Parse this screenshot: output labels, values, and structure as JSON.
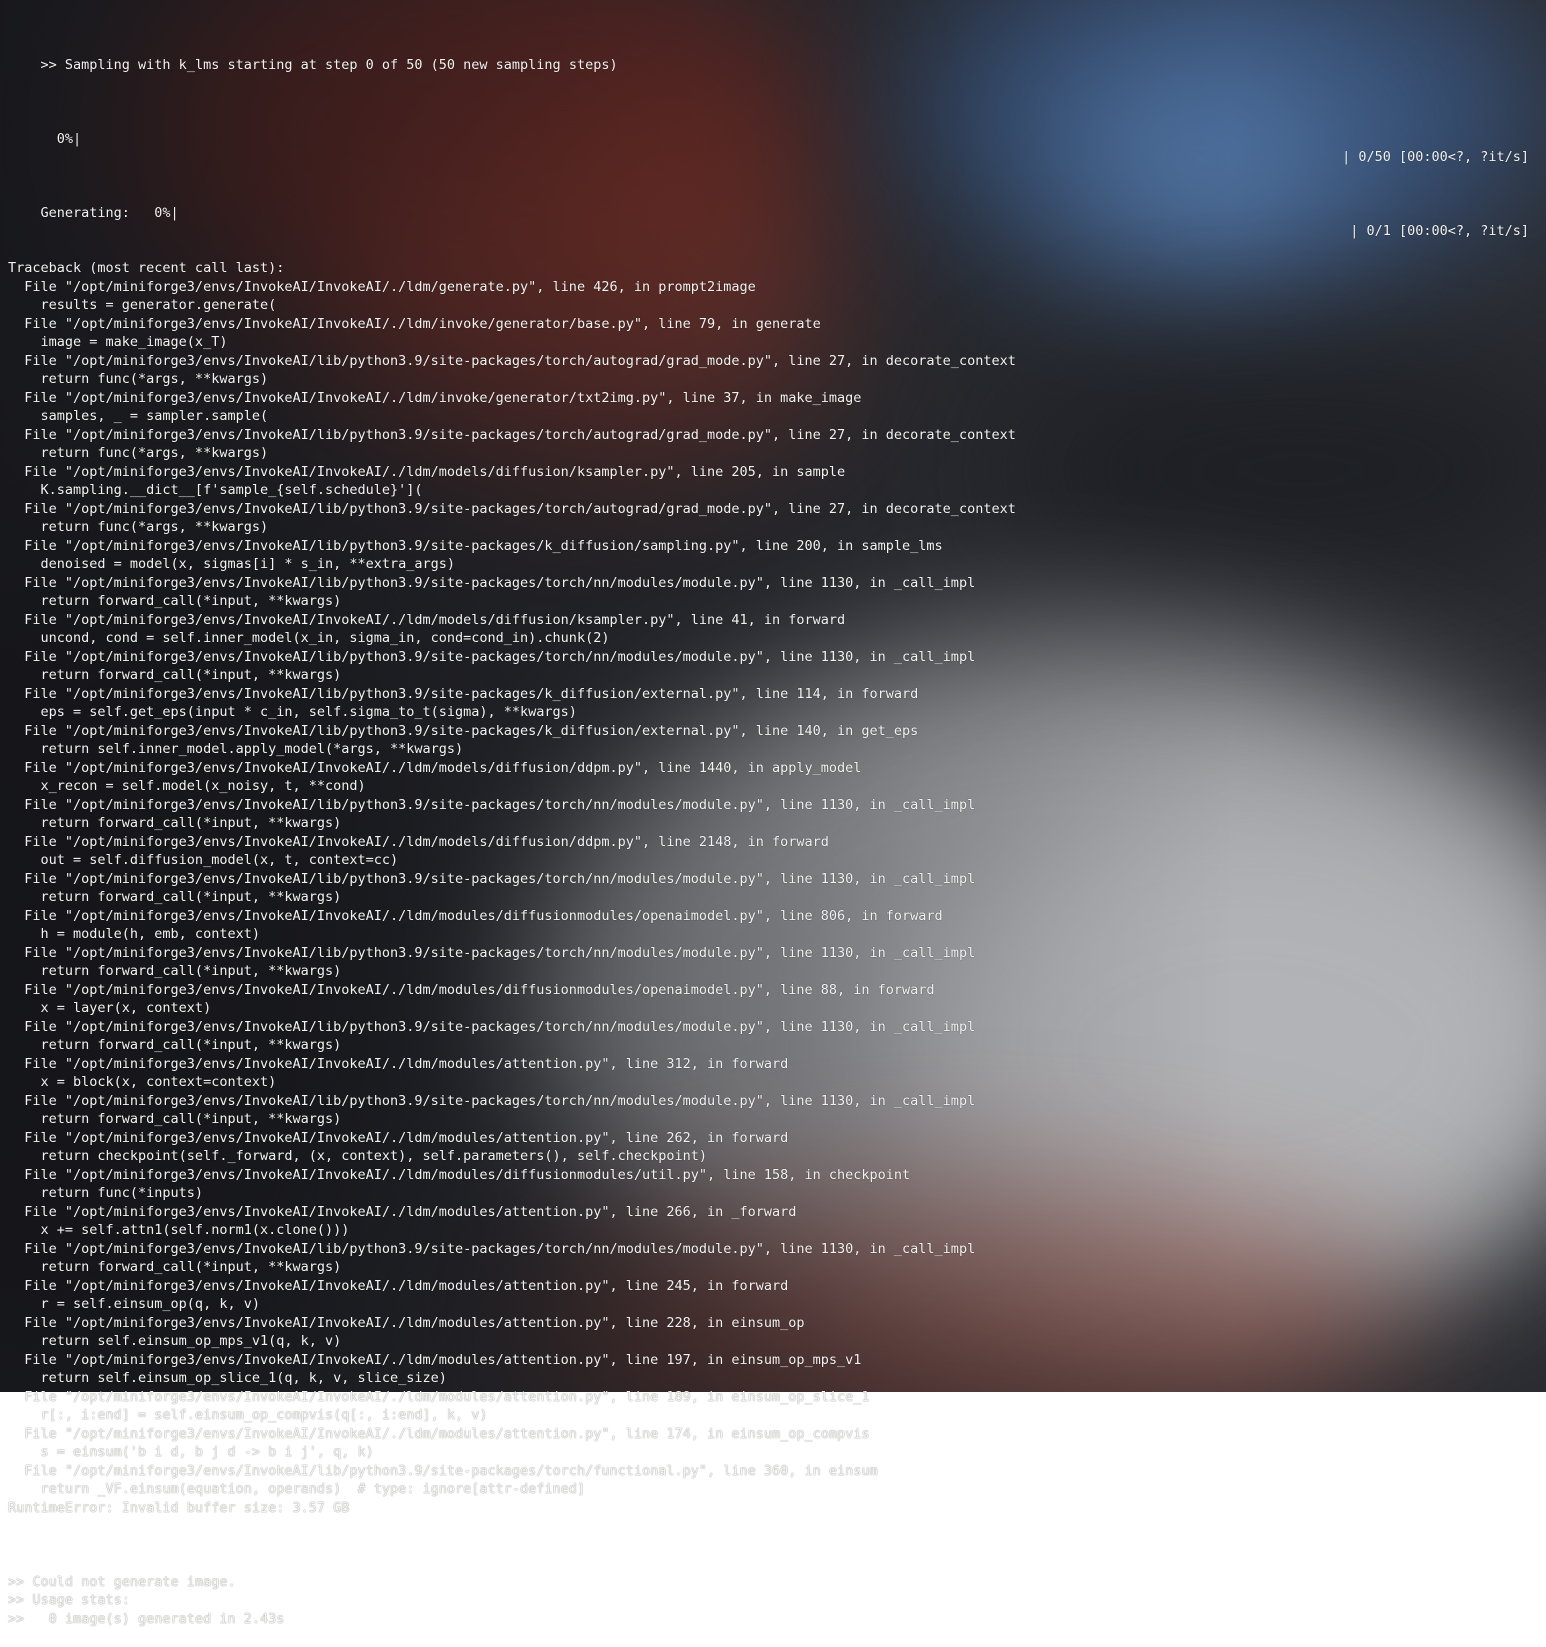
{
  "header": {
    "sampling_line": ">> Sampling with k_lms starting at step 0 of 50 (50 new sampling steps)",
    "progress_1_left": "  0%|",
    "progress_1_right": "| 0/50 [00:00<?, ?it/s]",
    "progress_2_left": "Generating:   0%|",
    "progress_2_right": "| 0/1 [00:00<?, ?it/s]"
  },
  "traceback_lines": [
    "Traceback (most recent call last):",
    "  File \"/opt/miniforge3/envs/InvokeAI/InvokeAI/./ldm/generate.py\", line 426, in prompt2image",
    "    results = generator.generate(",
    "  File \"/opt/miniforge3/envs/InvokeAI/InvokeAI/./ldm/invoke/generator/base.py\", line 79, in generate",
    "    image = make_image(x_T)",
    "  File \"/opt/miniforge3/envs/InvokeAI/lib/python3.9/site-packages/torch/autograd/grad_mode.py\", line 27, in decorate_context",
    "    return func(*args, **kwargs)",
    "  File \"/opt/miniforge3/envs/InvokeAI/InvokeAI/./ldm/invoke/generator/txt2img.py\", line 37, in make_image",
    "    samples, _ = sampler.sample(",
    "  File \"/opt/miniforge3/envs/InvokeAI/lib/python3.9/site-packages/torch/autograd/grad_mode.py\", line 27, in decorate_context",
    "    return func(*args, **kwargs)",
    "  File \"/opt/miniforge3/envs/InvokeAI/InvokeAI/./ldm/models/diffusion/ksampler.py\", line 205, in sample",
    "    K.sampling.__dict__[f'sample_{self.schedule}'](",
    "  File \"/opt/miniforge3/envs/InvokeAI/lib/python3.9/site-packages/torch/autograd/grad_mode.py\", line 27, in decorate_context",
    "    return func(*args, **kwargs)",
    "  File \"/opt/miniforge3/envs/InvokeAI/lib/python3.9/site-packages/k_diffusion/sampling.py\", line 200, in sample_lms",
    "    denoised = model(x, sigmas[i] * s_in, **extra_args)",
    "  File \"/opt/miniforge3/envs/InvokeAI/lib/python3.9/site-packages/torch/nn/modules/module.py\", line 1130, in _call_impl",
    "    return forward_call(*input, **kwargs)",
    "  File \"/opt/miniforge3/envs/InvokeAI/InvokeAI/./ldm/models/diffusion/ksampler.py\", line 41, in forward",
    "    uncond, cond = self.inner_model(x_in, sigma_in, cond=cond_in).chunk(2)",
    "  File \"/opt/miniforge3/envs/InvokeAI/lib/python3.9/site-packages/torch/nn/modules/module.py\", line 1130, in _call_impl",
    "    return forward_call(*input, **kwargs)",
    "  File \"/opt/miniforge3/envs/InvokeAI/lib/python3.9/site-packages/k_diffusion/external.py\", line 114, in forward",
    "    eps = self.get_eps(input * c_in, self.sigma_to_t(sigma), **kwargs)",
    "  File \"/opt/miniforge3/envs/InvokeAI/lib/python3.9/site-packages/k_diffusion/external.py\", line 140, in get_eps",
    "    return self.inner_model.apply_model(*args, **kwargs)",
    "  File \"/opt/miniforge3/envs/InvokeAI/InvokeAI/./ldm/models/diffusion/ddpm.py\", line 1440, in apply_model",
    "    x_recon = self.model(x_noisy, t, **cond)",
    "  File \"/opt/miniforge3/envs/InvokeAI/lib/python3.9/site-packages/torch/nn/modules/module.py\", line 1130, in _call_impl",
    "    return forward_call(*input, **kwargs)",
    "  File \"/opt/miniforge3/envs/InvokeAI/InvokeAI/./ldm/models/diffusion/ddpm.py\", line 2148, in forward",
    "    out = self.diffusion_model(x, t, context=cc)",
    "  File \"/opt/miniforge3/envs/InvokeAI/lib/python3.9/site-packages/torch/nn/modules/module.py\", line 1130, in _call_impl",
    "    return forward_call(*input, **kwargs)",
    "  File \"/opt/miniforge3/envs/InvokeAI/InvokeAI/./ldm/modules/diffusionmodules/openaimodel.py\", line 806, in forward",
    "    h = module(h, emb, context)",
    "  File \"/opt/miniforge3/envs/InvokeAI/lib/python3.9/site-packages/torch/nn/modules/module.py\", line 1130, in _call_impl",
    "    return forward_call(*input, **kwargs)",
    "  File \"/opt/miniforge3/envs/InvokeAI/InvokeAI/./ldm/modules/diffusionmodules/openaimodel.py\", line 88, in forward",
    "    x = layer(x, context)",
    "  File \"/opt/miniforge3/envs/InvokeAI/lib/python3.9/site-packages/torch/nn/modules/module.py\", line 1130, in _call_impl",
    "    return forward_call(*input, **kwargs)",
    "  File \"/opt/miniforge3/envs/InvokeAI/InvokeAI/./ldm/modules/attention.py\", line 312, in forward",
    "    x = block(x, context=context)",
    "  File \"/opt/miniforge3/envs/InvokeAI/lib/python3.9/site-packages/torch/nn/modules/module.py\", line 1130, in _call_impl",
    "    return forward_call(*input, **kwargs)",
    "  File \"/opt/miniforge3/envs/InvokeAI/InvokeAI/./ldm/modules/attention.py\", line 262, in forward",
    "    return checkpoint(self._forward, (x, context), self.parameters(), self.checkpoint)",
    "  File \"/opt/miniforge3/envs/InvokeAI/InvokeAI/./ldm/modules/diffusionmodules/util.py\", line 158, in checkpoint",
    "    return func(*inputs)",
    "  File \"/opt/miniforge3/envs/InvokeAI/InvokeAI/./ldm/modules/attention.py\", line 266, in _forward",
    "    x += self.attn1(self.norm1(x.clone()))",
    "  File \"/opt/miniforge3/envs/InvokeAI/lib/python3.9/site-packages/torch/nn/modules/module.py\", line 1130, in _call_impl",
    "    return forward_call(*input, **kwargs)",
    "  File \"/opt/miniforge3/envs/InvokeAI/InvokeAI/./ldm/modules/attention.py\", line 245, in forward",
    "    r = self.einsum_op(q, k, v)",
    "  File \"/opt/miniforge3/envs/InvokeAI/InvokeAI/./ldm/modules/attention.py\", line 228, in einsum_op",
    "    return self.einsum_op_mps_v1(q, k, v)",
    "  File \"/opt/miniforge3/envs/InvokeAI/InvokeAI/./ldm/modules/attention.py\", line 197, in einsum_op_mps_v1",
    "    return self.einsum_op_slice_1(q, k, v, slice_size)",
    "  File \"/opt/miniforge3/envs/InvokeAI/InvokeAI/./ldm/modules/attention.py\", line 189, in einsum_op_slice_1",
    "    r[:, i:end] = self.einsum_op_compvis(q[:, i:end], k, v)",
    "  File \"/opt/miniforge3/envs/InvokeAI/InvokeAI/./ldm/modules/attention.py\", line 174, in einsum_op_compvis",
    "    s = einsum('b i d, b j d -> b i j', q, k)",
    "  File \"/opt/miniforge3/envs/InvokeAI/lib/python3.9/site-packages/torch/functional.py\", line 360, in einsum",
    "    return _VF.einsum(equation, operands)  # type: ignore[attr-defined]",
    "RuntimeError: Invalid buffer size: 3.57 GB"
  ],
  "footer_lines": [
    "",
    ">> Could not generate image.",
    ">> Usage stats:",
    ">>   0 image(s) generated in 2.43s"
  ]
}
